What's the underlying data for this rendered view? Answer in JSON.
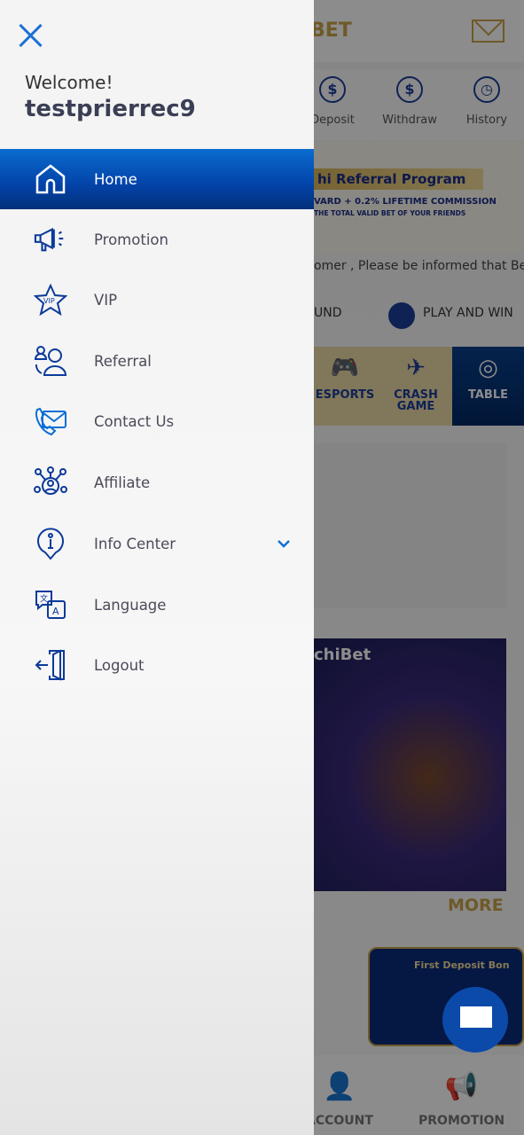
{
  "drawer": {
    "welcome": "Welcome!",
    "username": "testprierrec9",
    "items": [
      {
        "label": "Home",
        "icon": "home-icon",
        "active": true
      },
      {
        "label": "Promotion",
        "icon": "megaphone-icon"
      },
      {
        "label": "VIP",
        "icon": "vip-star-icon"
      },
      {
        "label": "Referral",
        "icon": "referral-users-icon"
      },
      {
        "label": "Contact Us",
        "icon": "contact-phone-mail-icon"
      },
      {
        "label": "Affiliate",
        "icon": "affiliate-network-icon"
      },
      {
        "label": "Info Center",
        "icon": "info-pin-icon",
        "expandable": true
      },
      {
        "label": "Language",
        "icon": "language-icon"
      },
      {
        "label": "Logout",
        "icon": "logout-icon"
      }
    ],
    "accent": "#0343a8"
  },
  "background": {
    "logo": "BET",
    "quick": [
      "Deposit",
      "Withdraw",
      "History"
    ],
    "banner_title": "hi Referral Program",
    "banner_sub1": "VARD + 0.2% LIFETIME COMMISSION",
    "banner_sub2": "THE TOTAL VALID BET OF YOUR FRIENDS",
    "marquee": "omer , Please be informed that Bet",
    "steps": [
      "UND",
      "PLAY AND WIN"
    ],
    "categories": [
      "ESPORTS",
      "CRASH GAME",
      "TABLE"
    ],
    "game_title": "chiBet",
    "more": "MORE",
    "promo_title": "First Deposit Bon",
    "bottom_nav": [
      "ACCOUNT",
      "PROMOTION"
    ]
  }
}
